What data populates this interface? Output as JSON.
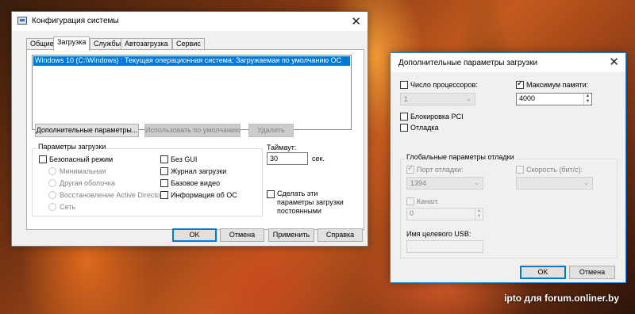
{
  "main_window": {
    "title": "Конфигурация системы",
    "tabs": [
      "Общие",
      "Загрузка",
      "Службы",
      "Автозагрузка",
      "Сервис"
    ],
    "active_tab": "Загрузка",
    "os_list": [
      "Windows 10 (C:\\Windows) : Текущая операционная система; Загружаемая по умолчанию ОС"
    ],
    "buttons": {
      "advanced": "Дополнительные параметры...",
      "set_default": "Использовать по умолчанию",
      "delete": "Удалить"
    },
    "boot_options": {
      "group_title": "Параметры загрузки",
      "safe_mode": "Безопасный режим",
      "radios": [
        "Минимальная",
        "Другая оболочка",
        "Восстановление Active Directory",
        "Сеть"
      ],
      "no_gui": "Без GUI",
      "boot_log": "Журнал загрузки",
      "base_video": "Базовое видео",
      "os_info": "Информация  об ОС"
    },
    "timeout": {
      "label": "Таймаут:",
      "value": "30",
      "unit": "сек."
    },
    "make_permanent": "Сделать эти параметры загрузки постоянными",
    "footer": {
      "ok": "OK",
      "cancel": "Отмена",
      "apply": "Применить",
      "help": "Справка"
    }
  },
  "advanced_dialog": {
    "title": "Дополнительные параметры загрузки",
    "num_procs": {
      "label": "Число процессоров:",
      "checked": false,
      "value": "1"
    },
    "max_memory": {
      "label": "Максимум памяти:",
      "checked": true,
      "value": "4000"
    },
    "pci_lock": "Блокировка PCI",
    "debug": "Отладка",
    "global_debug": {
      "group_title": "Глобальные параметры отладки",
      "debug_port": {
        "label": "Порт отладки:",
        "value": "1394"
      },
      "baud_rate": {
        "label": "Скорость (бит/с):"
      },
      "channel": {
        "label": "Канал:",
        "value": "0"
      },
      "usb_target": {
        "label": "Имя целевого USB:"
      }
    },
    "footer": {
      "ok": "OK",
      "cancel": "Отмена"
    }
  },
  "watermark": "ipto для forum.onliner.by"
}
